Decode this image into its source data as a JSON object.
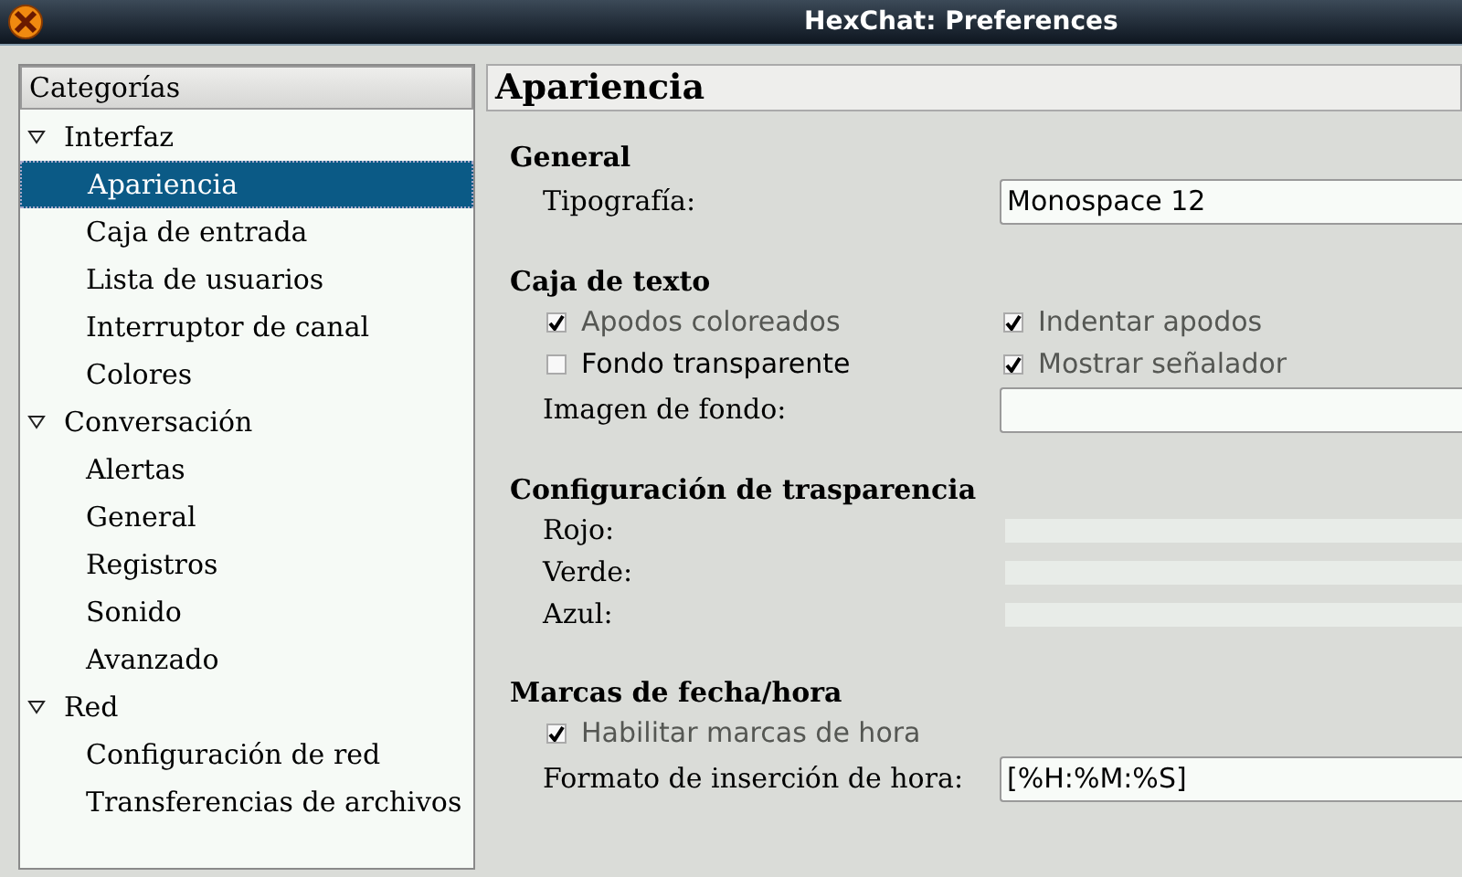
{
  "window": {
    "title": "HexChat: Preferences"
  },
  "sidebar": {
    "header": "Categorías",
    "items": [
      {
        "label": "Interfaz",
        "expanded": true,
        "selected": false,
        "children": [
          {
            "label": "Apariencia",
            "selected": true
          },
          {
            "label": "Caja de entrada",
            "selected": false
          },
          {
            "label": "Lista de usuarios",
            "selected": false
          },
          {
            "label": "Interruptor de canal",
            "selected": false
          },
          {
            "label": "Colores",
            "selected": false
          }
        ]
      },
      {
        "label": "Conversación",
        "expanded": true,
        "selected": false,
        "children": [
          {
            "label": "Alertas",
            "selected": false
          },
          {
            "label": "General",
            "selected": false
          },
          {
            "label": "Registros",
            "selected": false
          },
          {
            "label": "Sonido",
            "selected": false
          },
          {
            "label": "Avanzado",
            "selected": false
          }
        ]
      },
      {
        "label": "Red",
        "expanded": true,
        "selected": false,
        "children": [
          {
            "label": "Configuración de red",
            "selected": false
          },
          {
            "label": "Transferencias de archivos",
            "selected": false
          }
        ]
      }
    ]
  },
  "page": {
    "title": "Apariencia",
    "sections": [
      {
        "title": "General",
        "rows": [
          {
            "kind": "field",
            "label": "Tipografía:",
            "value": "Monospace 12"
          }
        ]
      },
      {
        "title": "Caja de texto",
        "rows": [
          {
            "kind": "checks",
            "items": [
              {
                "label": "Apodos coloreados",
                "checked": true,
                "disabled": true
              },
              {
                "label": "Indentar apodos",
                "checked": true,
                "disabled": true
              }
            ]
          },
          {
            "kind": "checks",
            "items": [
              {
                "label": "Fondo transparente",
                "checked": false,
                "disabled": false
              },
              {
                "label": "Mostrar señalador",
                "checked": true,
                "disabled": true
              }
            ]
          },
          {
            "kind": "field",
            "label": "Imagen de fondo:",
            "value": ""
          }
        ]
      },
      {
        "title": "Configuración de trasparencia",
        "rows": [
          {
            "kind": "slider",
            "label": "Rojo:"
          },
          {
            "kind": "slider",
            "label": "Verde:"
          },
          {
            "kind": "slider",
            "label": "Azul:"
          }
        ]
      },
      {
        "title": "Marcas de fecha/hora",
        "rows": [
          {
            "kind": "checks",
            "items": [
              {
                "label": "Habilitar marcas de hora",
                "checked": true,
                "disabled": true
              }
            ]
          },
          {
            "kind": "field",
            "label": "Formato de inserción de hora:",
            "value": "[%H:%M:%S]"
          }
        ]
      }
    ]
  }
}
